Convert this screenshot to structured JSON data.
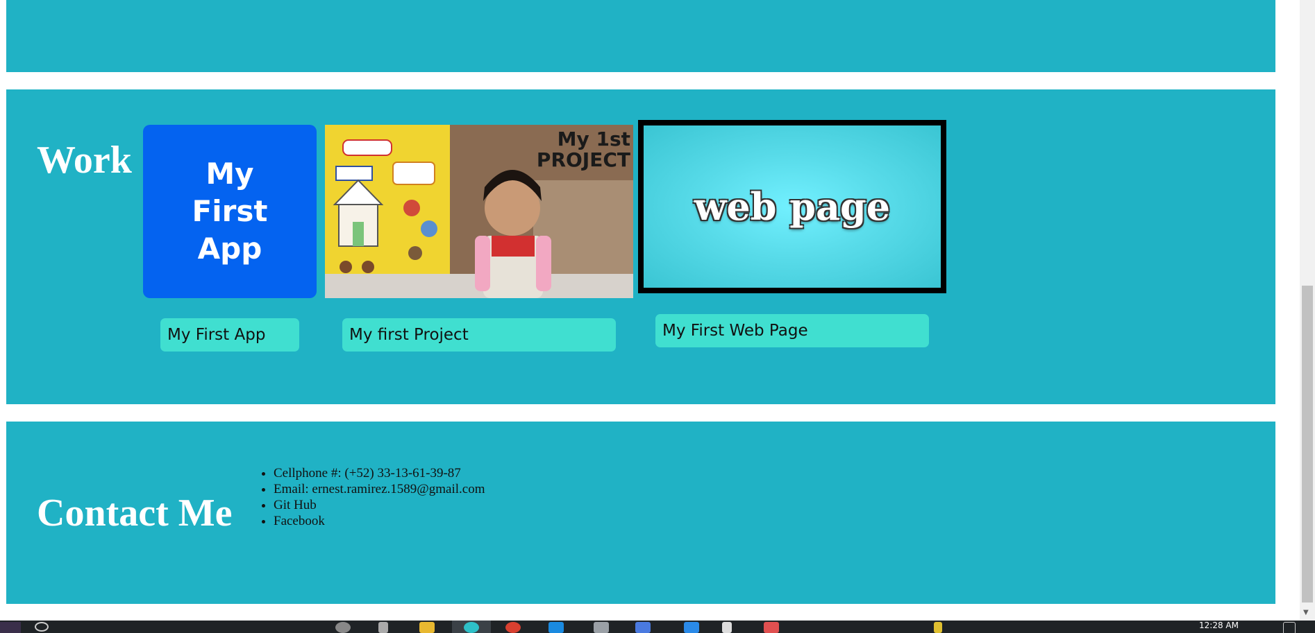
{
  "work": {
    "heading": "Work",
    "items": [
      {
        "thumb_lines": [
          "My",
          "First",
          "App"
        ],
        "button_label": "My First App"
      },
      {
        "thumb_caption_line1": "My 1st",
        "thumb_caption_line2": "PROJECT",
        "button_label": "My first Project"
      },
      {
        "thumb_text": "web page",
        "button_label": "My First Web Page"
      }
    ]
  },
  "contact": {
    "heading": "Contact Me",
    "items": [
      "Cellphone #: (+52) 33-13-61-39-87",
      "Email: ernest.ramirez.1589@gmail.com",
      "Git Hub",
      "Facebook"
    ]
  },
  "taskbar": {
    "clock": "12:28 AM"
  },
  "colors": {
    "section_bg": "#20b2c5",
    "button_bg": "#40dfd0",
    "app_tile": "#0463f0"
  }
}
